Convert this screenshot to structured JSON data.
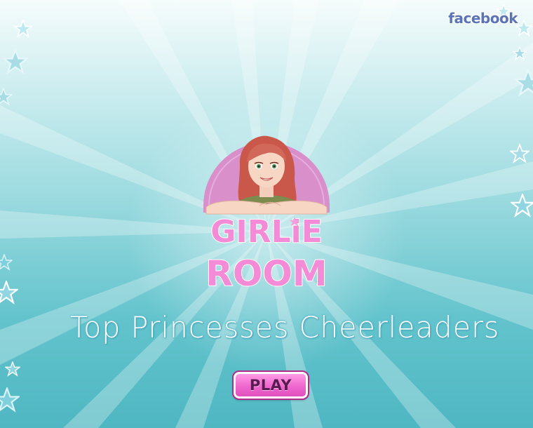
{
  "header": {
    "facebook_label": "facebook"
  },
  "logo": {
    "brand_line1": "GIRLiE",
    "brand_line2": "ROOM",
    "circle_color": "#d98fc9"
  },
  "game": {
    "title": "Top Princesses Cheerleaders"
  },
  "play_button": {
    "label": "PLAY",
    "color": "#f06bd0"
  },
  "background": {
    "colors": [
      "#f6fcfc",
      "#9ddbe0",
      "#4fb7c2"
    ],
    "decoration": "star-icon"
  }
}
